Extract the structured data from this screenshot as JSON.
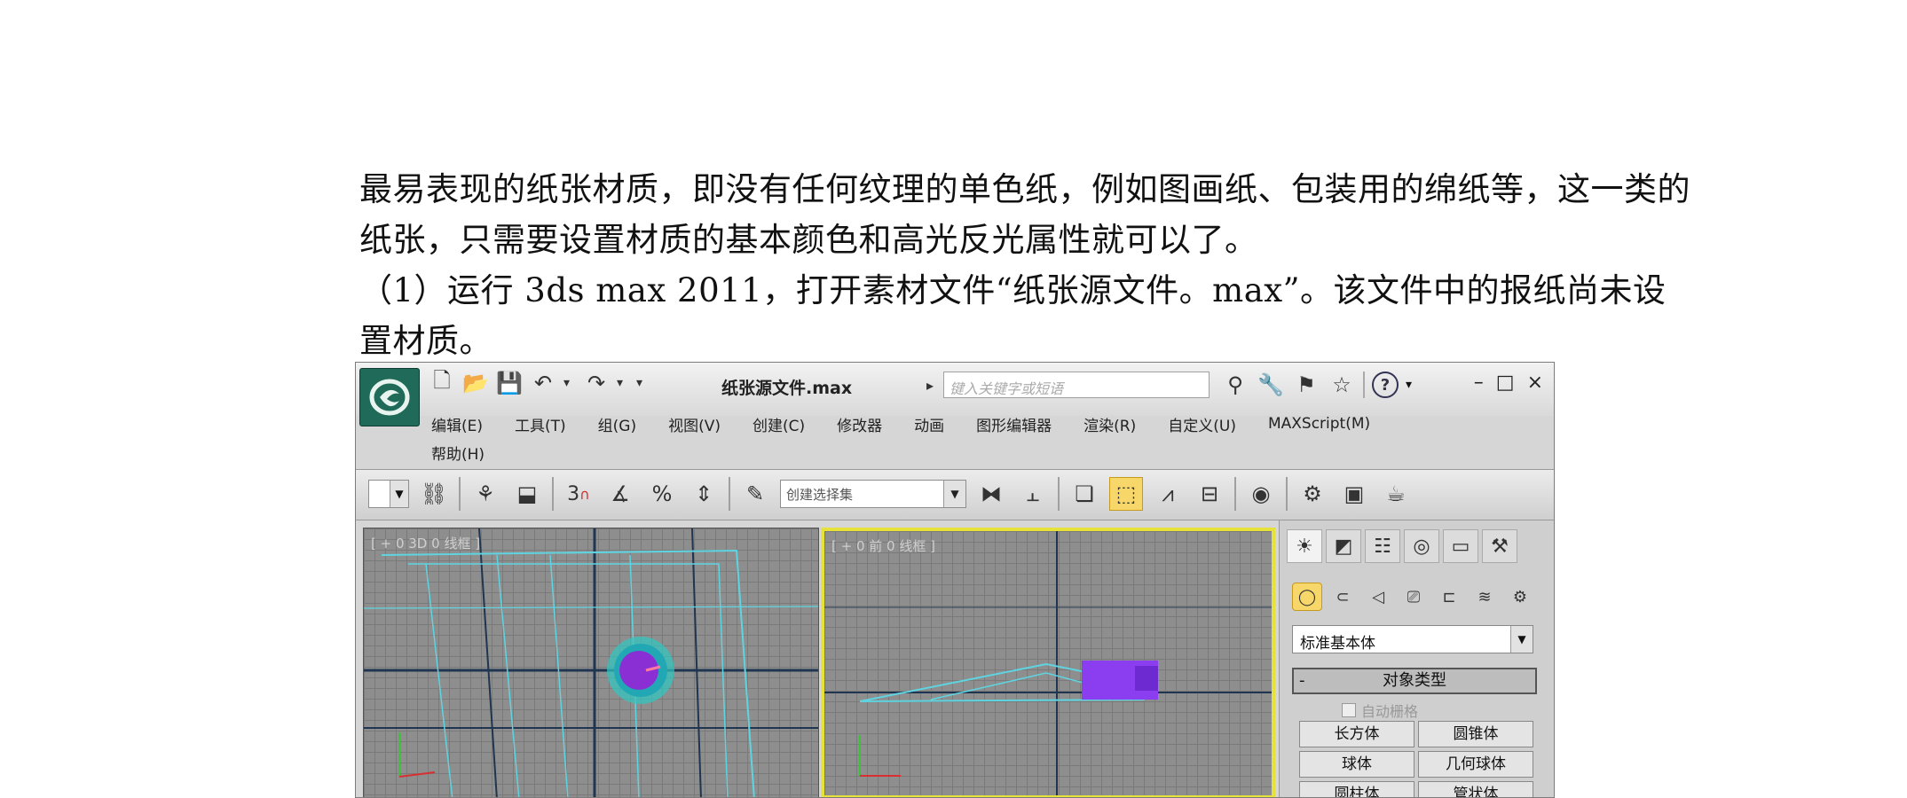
{
  "document": {
    "paragraph1": "最易表现的纸张材质，即没有任何纹理的单色纸，例如图画纸、包装用的绵纸等，这一类的纸张，只需要设置材质的基本颜色和高光反光属性就可以了。",
    "paragraph2": "（1）运行 3ds max 2011，打开素材文件“纸张源文件。max”。该文件中的报纸尚未设置材质。"
  },
  "app": {
    "title": "纸张源文件.max",
    "search_placeholder": "键入关键字或短语",
    "menus": [
      "编辑(E)",
      "工具(T)",
      "组(G)",
      "视图(V)",
      "创建(C)",
      "修改器",
      "动画",
      "图形编辑器",
      "渲染(R)",
      "自定义(U)",
      "MAXScript(M)"
    ],
    "help_menu": "帮助(H)",
    "selection_set_placeholder": "创建选择集",
    "snap_label": "3",
    "colors": {
      "logo": "#1f6a58",
      "active_viewport_border": "#e6e23a",
      "active_button": "#f7d66a"
    }
  },
  "viewports": {
    "left_label": "[ + 0 3D 0 线框 ]",
    "right_label": "[ + 0 前 0 线框 ]"
  },
  "command_panel": {
    "category": "标准基本体",
    "rollout_title": "对象类型",
    "autogrid_label": "自动栅格",
    "object_buttons": [
      "长方体",
      "圆锥体",
      "球体",
      "几何球体",
      "圆柱体",
      "管状体"
    ]
  }
}
